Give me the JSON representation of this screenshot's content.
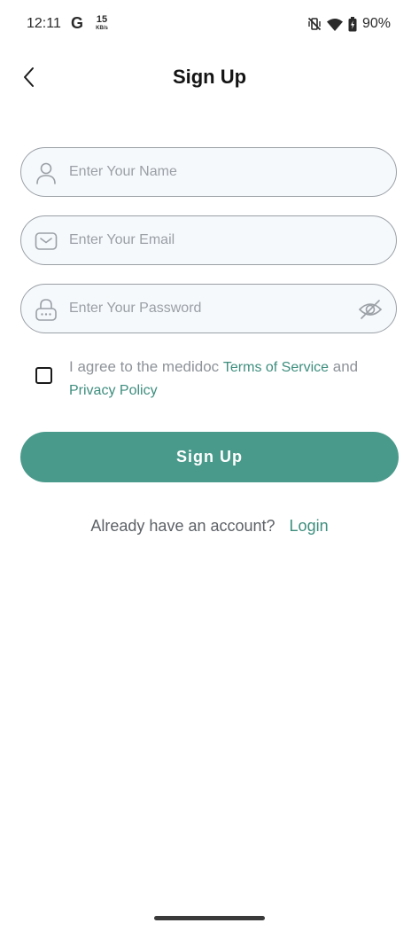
{
  "status_bar": {
    "time": "12:11",
    "google_icon_letter": "G",
    "network_speed": "15",
    "network_speed_unit": "KB/s",
    "battery_percent": "90%",
    "icons": [
      "mute-vibrate-icon",
      "wifi-icon",
      "battery-charging-icon"
    ]
  },
  "header": {
    "title": "Sign Up",
    "back_icon": "chevron-left-icon"
  },
  "form": {
    "name": {
      "value": "",
      "placeholder": "Enter Your Name",
      "icon": "user-icon"
    },
    "email": {
      "value": "",
      "placeholder": "Enter Your Email",
      "icon": "envelope-icon"
    },
    "password": {
      "value": "",
      "placeholder": "Enter Your Password",
      "icon": "lock-icon",
      "toggle_icon": "eye-off-icon"
    }
  },
  "agreement": {
    "checked": false,
    "text_prefix": "I agree to the medidoc ",
    "terms_link": "Terms of Service",
    "connector": " and",
    "privacy_link": "Privacy Policy"
  },
  "signup_button": {
    "label": "Sign Up"
  },
  "login_prompt": {
    "text": "Already have an account?",
    "link": "Login"
  },
  "colors": {
    "accent": "#4a9a8b",
    "link": "#3e8e7e",
    "field_background": "#f6f9fc",
    "field_border": "#9aa0a6"
  }
}
